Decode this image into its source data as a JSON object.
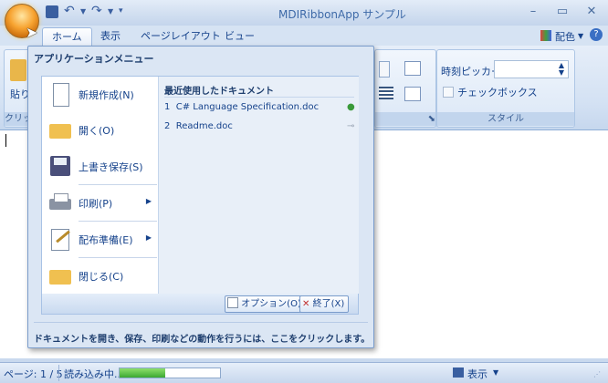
{
  "window": {
    "title": "MDIRibbonApp サンプル"
  },
  "tabs": [
    {
      "label": "ホーム"
    },
    {
      "label": "表示"
    },
    {
      "label": "ページレイアウト"
    },
    {
      "label": "ビュー"
    }
  ],
  "ribbon": {
    "right_label": "配色",
    "time_picker_label": "時刻ピッカー",
    "checkbox_label": "チェックボックス",
    "style_group": "スタイル",
    "paste_label": "貼り",
    "clipboard_group": "クリッ"
  },
  "app_menu": {
    "title": "アプリケーションメニュー",
    "items": [
      {
        "label": "新規作成(N)",
        "icon": "new-document-icon"
      },
      {
        "label": "開く(O)",
        "icon": "open-folder-icon"
      },
      {
        "label": "上書き保存(S)",
        "icon": "save-icon"
      },
      {
        "label": "印刷(P)",
        "icon": "printer-icon"
      },
      {
        "label": "配布準備(E)",
        "icon": "prepare-icon"
      },
      {
        "label": "閉じる(C)",
        "icon": "close-folder-icon"
      }
    ],
    "recent_header": "最近使用したドキュメント",
    "recent": [
      {
        "index": "1",
        "name": "C# Language Specification.doc"
      },
      {
        "index": "2",
        "name": "Readme.doc"
      }
    ],
    "options_label": "オプション(O)",
    "exit_label": "終了(X)",
    "hint": "ドキュメントを開き、保存、印刷などの動作を行うには、ここをクリックします。"
  },
  "status": {
    "page": "ページ: 1 / 5",
    "loading": "読み込み中...",
    "progress": 0.45,
    "view_label": "表示"
  }
}
